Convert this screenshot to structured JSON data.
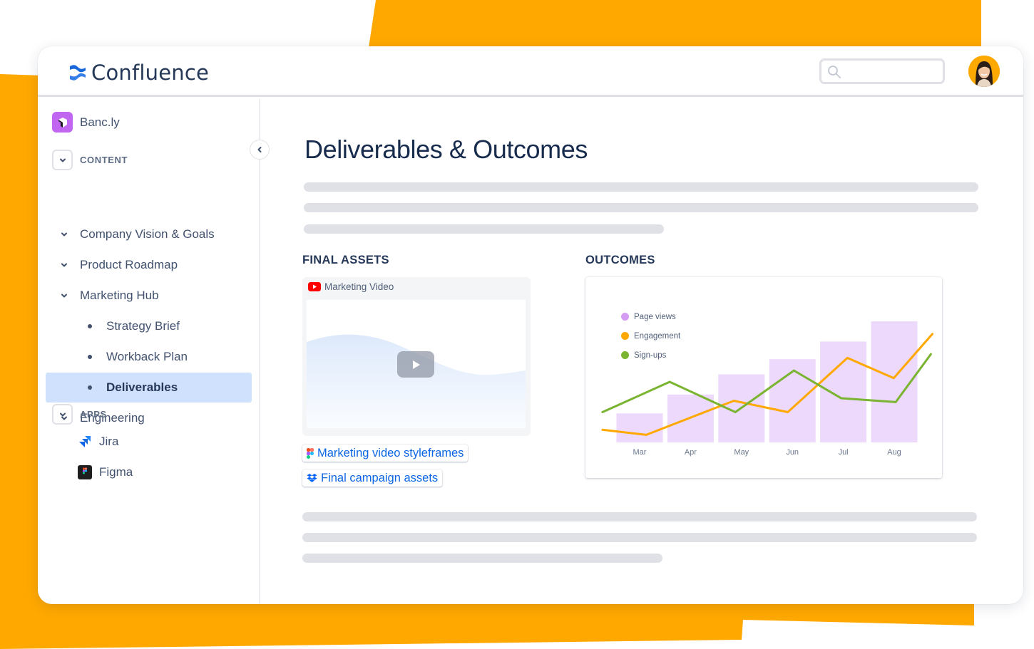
{
  "app": {
    "name": "Confluence",
    "logo_icon": "confluence-logo-icon",
    "search": {
      "placeholder": "",
      "value": "",
      "icon": "search-icon"
    },
    "avatar": {
      "icon": "user-avatar",
      "bg_color": "#FFA800"
    }
  },
  "theme": {
    "accent_bg": "#FFA800",
    "link_color": "#0C66E4",
    "active_nav_bg": "#CFE1FD"
  },
  "sidebar": {
    "space": {
      "name": "Banc.ly",
      "icon": "space-logo-icon",
      "color": "#C066F0"
    },
    "collapse_button": {
      "icon": "chevron-left-icon"
    },
    "content_section": {
      "label": "CONTENT",
      "icon": "chevron-down-icon"
    },
    "items": [
      {
        "label": "Company Vision & Goals",
        "level": 0,
        "icon": "chevron-down-icon",
        "active": false
      },
      {
        "label": "Product Roadmap",
        "level": 0,
        "icon": "chevron-down-icon",
        "active": false
      },
      {
        "label": "Marketing Hub",
        "level": 0,
        "icon": "chevron-down-icon",
        "active": false
      },
      {
        "label": "Strategy Brief",
        "level": 1,
        "icon": "bullet",
        "active": false
      },
      {
        "label": "Workback Plan",
        "level": 1,
        "icon": "bullet",
        "active": false
      },
      {
        "label": "Deliverables",
        "level": 1,
        "icon": "bullet",
        "active": true
      },
      {
        "label": "Engineering",
        "level": 0,
        "icon": "chevron-down-icon",
        "active": false
      }
    ],
    "apps_section": {
      "label": "APPS",
      "icon": "chevron-down-icon"
    },
    "apps": [
      {
        "label": "Jira",
        "icon": "jira-icon"
      },
      {
        "label": "Figma",
        "icon": "figma-icon"
      }
    ]
  },
  "main": {
    "title": "Deliverables & Outcomes",
    "final_assets": {
      "heading": "FINAL ASSETS",
      "video": {
        "title": "Marketing Video",
        "icon": "youtube-icon",
        "play_icon": "play-icon"
      },
      "links": [
        {
          "label": "Marketing video styleframes",
          "icon": "figma-icon"
        },
        {
          "label": "Final campaign assets",
          "icon": "dropbox-icon"
        }
      ]
    },
    "outcomes": {
      "heading": "OUTCOMES"
    }
  },
  "chart_data": {
    "type": "bar",
    "title": "",
    "xlabel": "",
    "ylabel": "",
    "categories": [
      "Mar",
      "Apr",
      "May",
      "Jun",
      "Jul",
      "Aug"
    ],
    "ylim": [
      0,
      100
    ],
    "grid": false,
    "legend_position": "top-left",
    "series": [
      {
        "name": "Page views",
        "kind": "bar",
        "color": "#D59CF5",
        "fill": "#ECD9FB",
        "values": [
          23,
          38,
          54,
          66,
          80,
          96
        ]
      },
      {
        "name": "Engagement",
        "kind": "line",
        "color": "#FFA800",
        "x": [
          -0.73,
          0.13,
          1.85,
          2.91,
          4.08,
          4.99,
          5.75
        ],
        "y": [
          10,
          6,
          33,
          24,
          67,
          51,
          86
        ]
      },
      {
        "name": "Sign-ups",
        "kind": "line",
        "color": "#7AB431",
        "x": [
          -0.73,
          0.59,
          1.88,
          3.03,
          3.96,
          5.03,
          5.72
        ],
        "y": [
          24,
          48,
          24,
          57,
          35,
          32,
          70
        ]
      }
    ]
  }
}
